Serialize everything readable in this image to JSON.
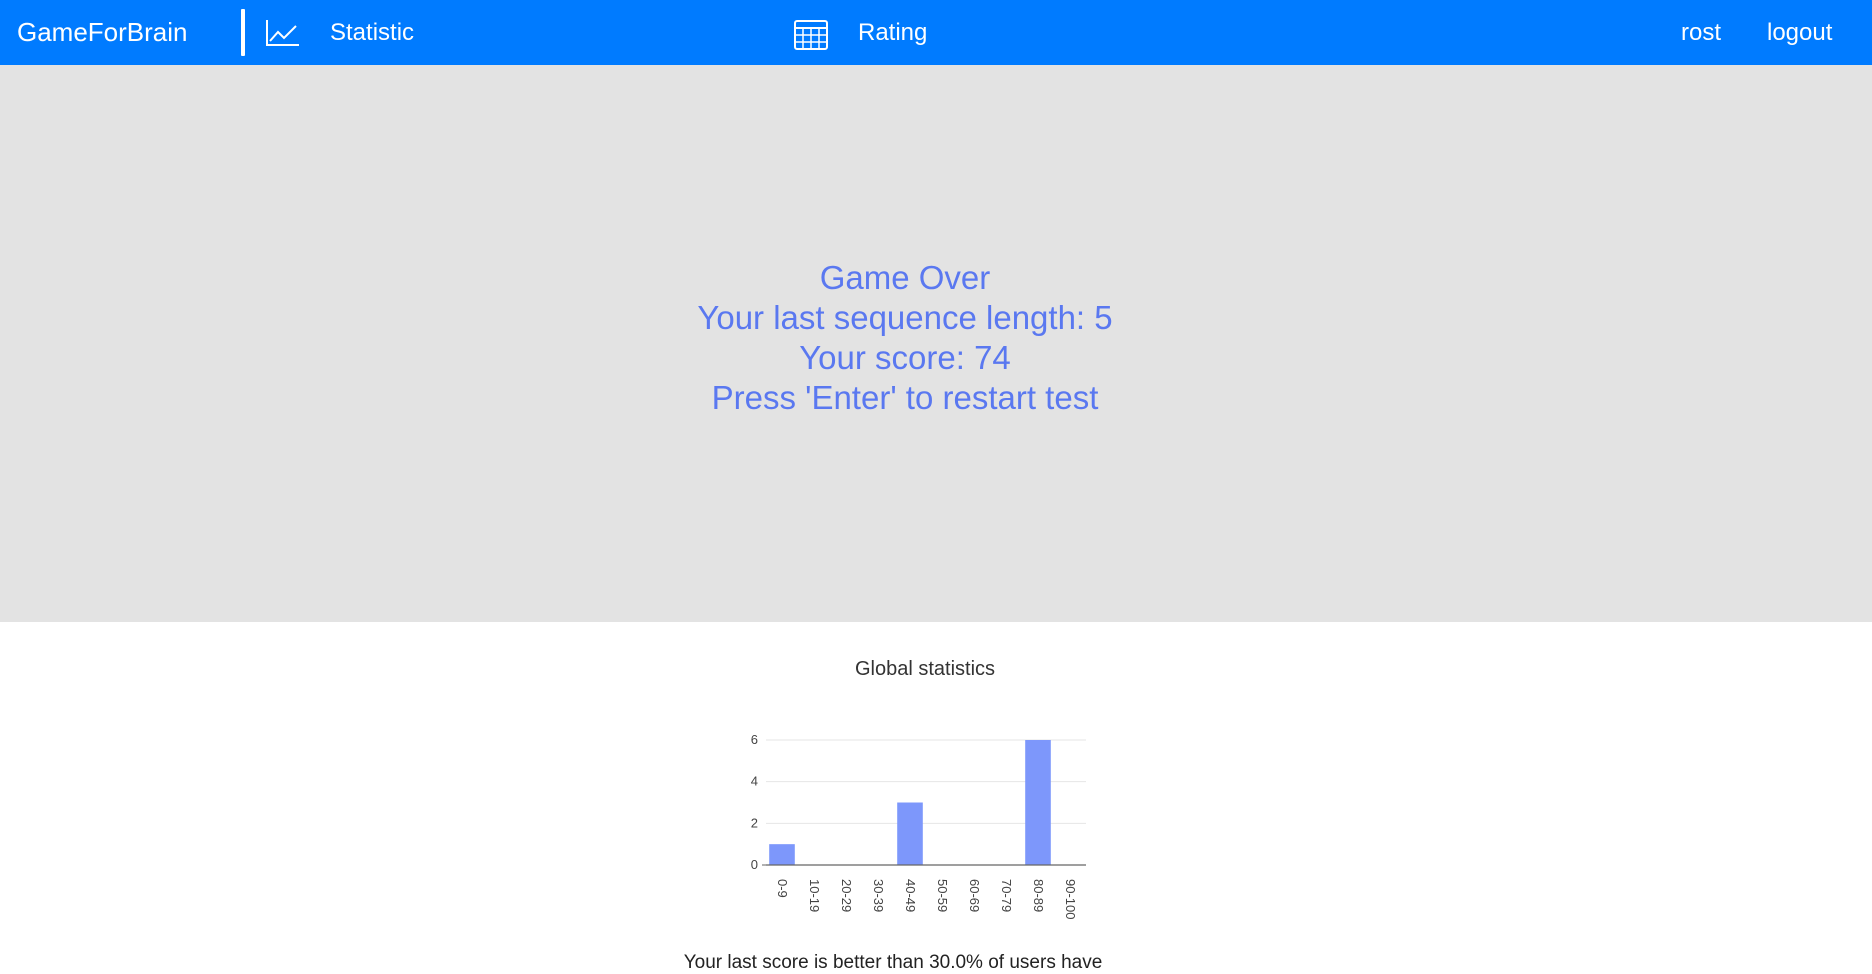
{
  "navbar": {
    "brand": "GameForBrain",
    "statistic_label": "Statistic",
    "rating_label": "Rating",
    "user_label": "rost",
    "logout_label": "logout",
    "icons": [
      "line-chart-icon",
      "table-icon"
    ],
    "color": "#007bff"
  },
  "game": {
    "line1": "Game Over",
    "line2": "Your last sequence length: 5",
    "line3": "Your score: 74",
    "line4": "Press 'Enter' to restart test"
  },
  "stats": {
    "title": "Global statistics",
    "footer": "Your last score is better than 30.0% of users have"
  },
  "chart_data": {
    "type": "bar",
    "title": "Global statistics",
    "categories": [
      "0-9",
      "10-19",
      "20-29",
      "30-39",
      "40-49",
      "50-59",
      "60-69",
      "70-79",
      "80-89",
      "90-100"
    ],
    "values": [
      1,
      0,
      0,
      0,
      3,
      0,
      0,
      0,
      6,
      0
    ],
    "y_ticks": [
      "0",
      "2",
      "4",
      "6"
    ],
    "ylim": [
      0,
      6
    ],
    "grid": true,
    "bar_color": "#7d97fb"
  }
}
